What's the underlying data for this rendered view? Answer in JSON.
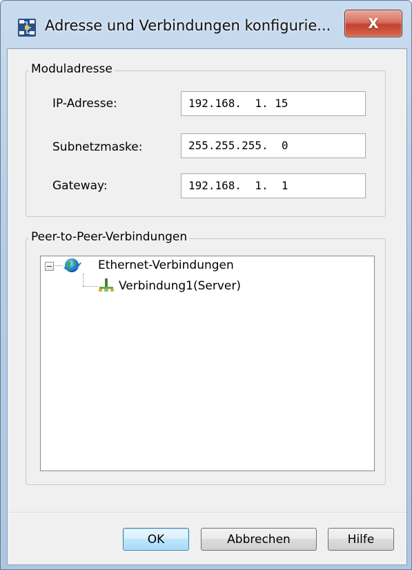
{
  "window": {
    "title": "Adresse und Verbindungen konfigurie...",
    "close_glyph": "X",
    "icon": "module-config-icon"
  },
  "module_address": {
    "group_label": "Moduladresse",
    "fields": [
      {
        "label": "IP-Adresse:",
        "value": "192.168.  1. 15"
      },
      {
        "label": "Subnetzmaske:",
        "value": "255.255.255.  0"
      },
      {
        "label": "Gateway:",
        "value": "192.168.  1.  1"
      }
    ]
  },
  "peer_to_peer": {
    "group_label": "Peer-to-Peer-Verbindungen",
    "tree": {
      "root": {
        "label": "Ethernet-Verbindungen",
        "icon": "globe-icon",
        "expanded": true
      },
      "children": [
        {
          "label": "Verbindung1(Server)",
          "icon": "network-connection-icon"
        }
      ]
    }
  },
  "buttons": {
    "ok": "OK",
    "cancel": "Abbrechen",
    "help": "Hilfe"
  },
  "colors": {
    "frame": "#b7cde4",
    "close_button": "#c4412d",
    "client_bg": "#f0f0f0",
    "default_button": "#bee6fd"
  }
}
